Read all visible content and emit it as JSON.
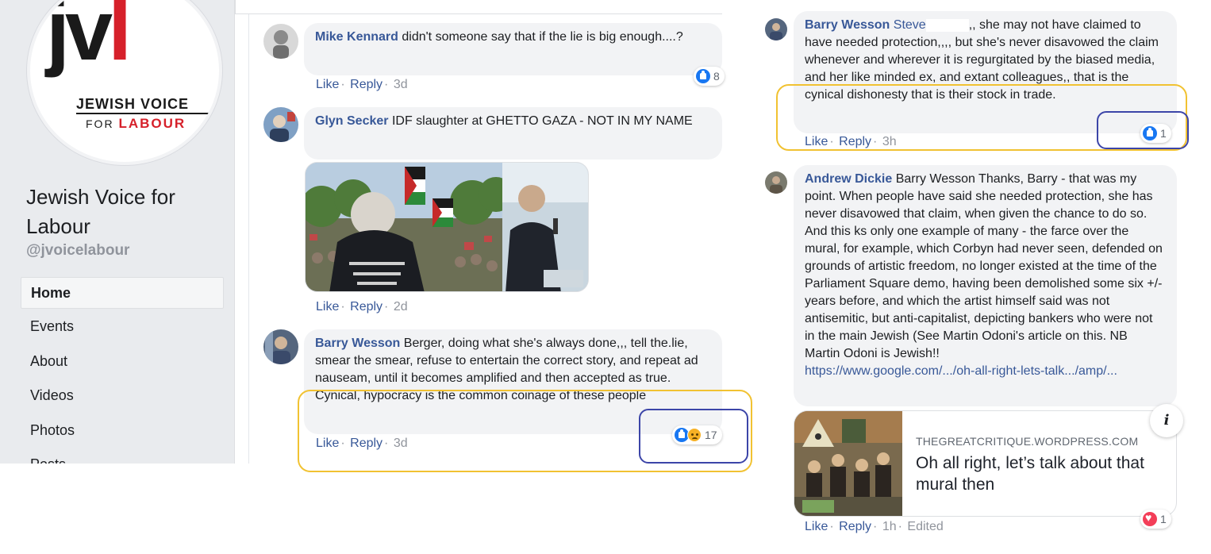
{
  "sidebar": {
    "logo": {
      "main": "jvl",
      "line1": "JEWISH VOICE",
      "line2_prefix": "FOR",
      "line2_accent": "LABOUR"
    },
    "page_name": "Jewish Voice for Labour",
    "handle": "@jvoicelabour",
    "nav": [
      {
        "label": "Home",
        "active": true
      },
      {
        "label": "Events"
      },
      {
        "label": "About"
      },
      {
        "label": "Videos"
      },
      {
        "label": "Photos"
      },
      {
        "label": "Posts"
      }
    ]
  },
  "comments": {
    "mike": {
      "author": "Mike Kennard",
      "text": "didn't someone say that if the lie is big enough....?",
      "like": "Like",
      "reply": "Reply",
      "time": "3d",
      "reaction_count": "8"
    },
    "glyn": {
      "author": "Glyn Secker",
      "text": "IDF slaughter at GHETTO GAZA - NOT IN MY NAME",
      "like": "Like",
      "reply": "Reply",
      "time": "2d"
    },
    "barry_mid": {
      "author": "Barry Wesson",
      "text": "Berger, doing what she's always done,,, tell the.lie, smear the smear, refuse to entertain the correct story, and repeat ad nauseam, until it becomes amplified and then accepted as true. Cynical, hypocracy is the common coinage of these people",
      "like": "Like",
      "reply": "Reply",
      "time": "3d",
      "reaction_count": "17"
    },
    "barry_right": {
      "author": "Barry Wesson",
      "mention": "Steve",
      "text": ",, she may not have claimed to have needed protection,,,, but she's never disavowed the claim whenever and wherever it is regurgitated by the biased media, and her like minded ex, and extant colleagues,, that is the cynical dishonesty that is their stock in trade.",
      "like": "Like",
      "reply": "Reply",
      "time": "3h",
      "reaction_count": "1"
    },
    "andrew": {
      "author": "Andrew Dickie",
      "text": "Barry Wesson Thanks, Barry - that was my point. When people have said she needed protection, she has never disavowed that claim, when given the chance to do so. And this ks only one example of many - the farce over the mural, for example, which Corbyn had never seen, defended on grounds of artistic freedom, no longer existed at the time of the Parliament Square demo, having been demolished some six +/- years before, and which the artist himself said was not antisemitic, but anti-capitalist, depicting bankers who were not in the main Jewish (See Martin Odoni's article on this. NB Martin Odoni is Jewish!!",
      "link": "https://www.google.com/.../oh-all-right-lets-talk.../amp/...",
      "preview_domain": "THEGREATCRITIQUE.WORDPRESS.COM",
      "preview_title": "Oh all right, let’s talk about that mural then",
      "like": "Like",
      "reply": "Reply",
      "time": "1h",
      "edited": "Edited",
      "reaction_count": "1"
    }
  },
  "colors": {
    "link_blue": "#385898",
    "highlight_yellow": "#f1c232",
    "highlight_blue": "#3c45a8",
    "like_blue": "#1877f2",
    "logo_red": "#d6202a"
  }
}
